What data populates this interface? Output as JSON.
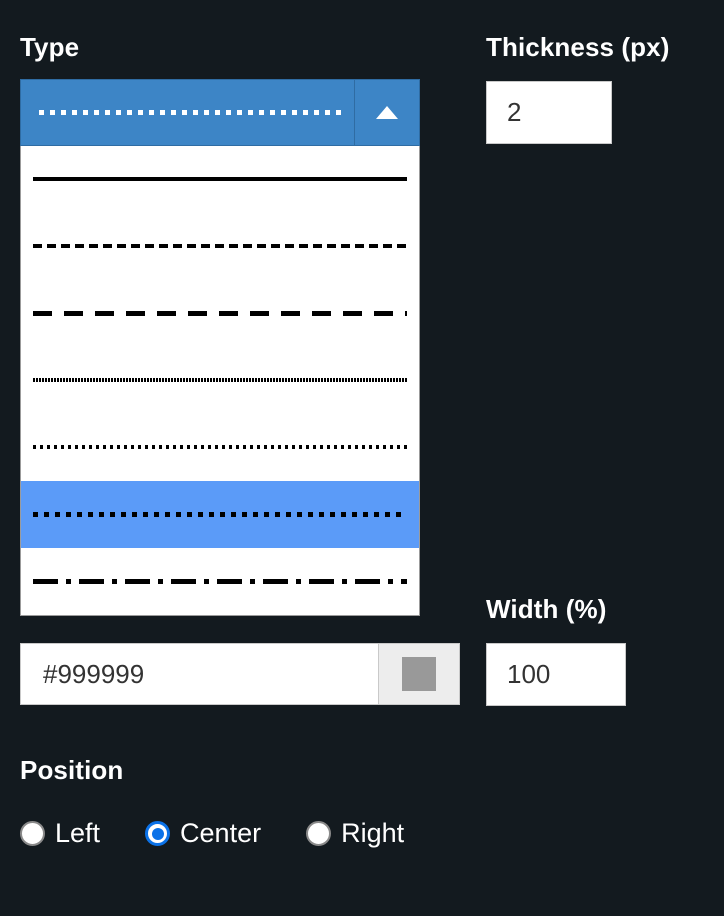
{
  "background_color": "#131a1f",
  "accent_color": "#3d85c6",
  "highlight_color": "#5b9bf8",
  "radio_checked_color": "#0b72e8",
  "type_field": {
    "label": "Type",
    "selected_option_id": "dotted-large",
    "dropdown_open": true,
    "caret_icon": "caret-up-icon",
    "options": [
      {
        "id": "solid",
        "pattern": "solid",
        "selected": false
      },
      {
        "id": "dash-small",
        "pattern": "dash-small",
        "selected": false
      },
      {
        "id": "dash-large",
        "pattern": "dash-large",
        "selected": false
      },
      {
        "id": "dot-dense",
        "pattern": "dot-dense",
        "selected": false
      },
      {
        "id": "dot-small",
        "pattern": "dot-small",
        "selected": false
      },
      {
        "id": "dotted-large",
        "pattern": "dot-large",
        "selected": true
      },
      {
        "id": "dash-dot",
        "pattern": "dash-dot",
        "selected": false
      }
    ]
  },
  "thickness_field": {
    "label": "Thickness (px)",
    "value": "2",
    "placeholder": ""
  },
  "width_field": {
    "label": "Width (%)",
    "value": "100",
    "placeholder": ""
  },
  "color_field": {
    "value": "#999999",
    "placeholder": "#999999",
    "swatch_color": "#999999",
    "swatch_icon": "color-swatch-icon"
  },
  "position_field": {
    "label": "Position",
    "selected": "Center",
    "options": [
      {
        "label": "Left",
        "checked": false
      },
      {
        "label": "Center",
        "checked": true
      },
      {
        "label": "Right",
        "checked": false
      }
    ]
  }
}
